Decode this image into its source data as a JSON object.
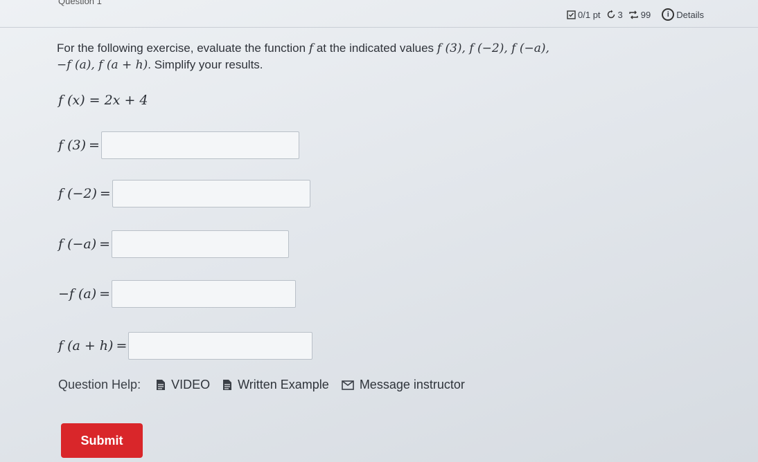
{
  "question": {
    "title": "Question 1",
    "points": "0/1 pt",
    "retries": "3",
    "attempts": "99",
    "details_label": "Details"
  },
  "prompt": {
    "text_start": "For the following exercise, evaluate the function ",
    "func": "f",
    "text_mid": " at the indicated values ",
    "values_list": "f (3), f (−2), f (−a),",
    "values_list_2": "−f (a), f (a + h)",
    "text_end": ". Simplify your results."
  },
  "given": "f (x) = 2x + 4",
  "parts": [
    {
      "label": "f (3)",
      "value": "",
      "placeholder": ""
    },
    {
      "label": "f (−2)",
      "value": "",
      "placeholder": ""
    },
    {
      "label": "f (−a)",
      "value": "",
      "placeholder": ""
    },
    {
      "label": "−f (a)",
      "value": "",
      "placeholder": ""
    },
    {
      "label": "f (a + h)",
      "value": "",
      "placeholder": ""
    }
  ],
  "equals": "=",
  "help": {
    "title": "Question Help:",
    "video": "VIDEO",
    "written": "Written Example",
    "message": "Message instructor"
  },
  "submit_label": "Submit",
  "colors": {
    "submit": "#d9262a"
  }
}
